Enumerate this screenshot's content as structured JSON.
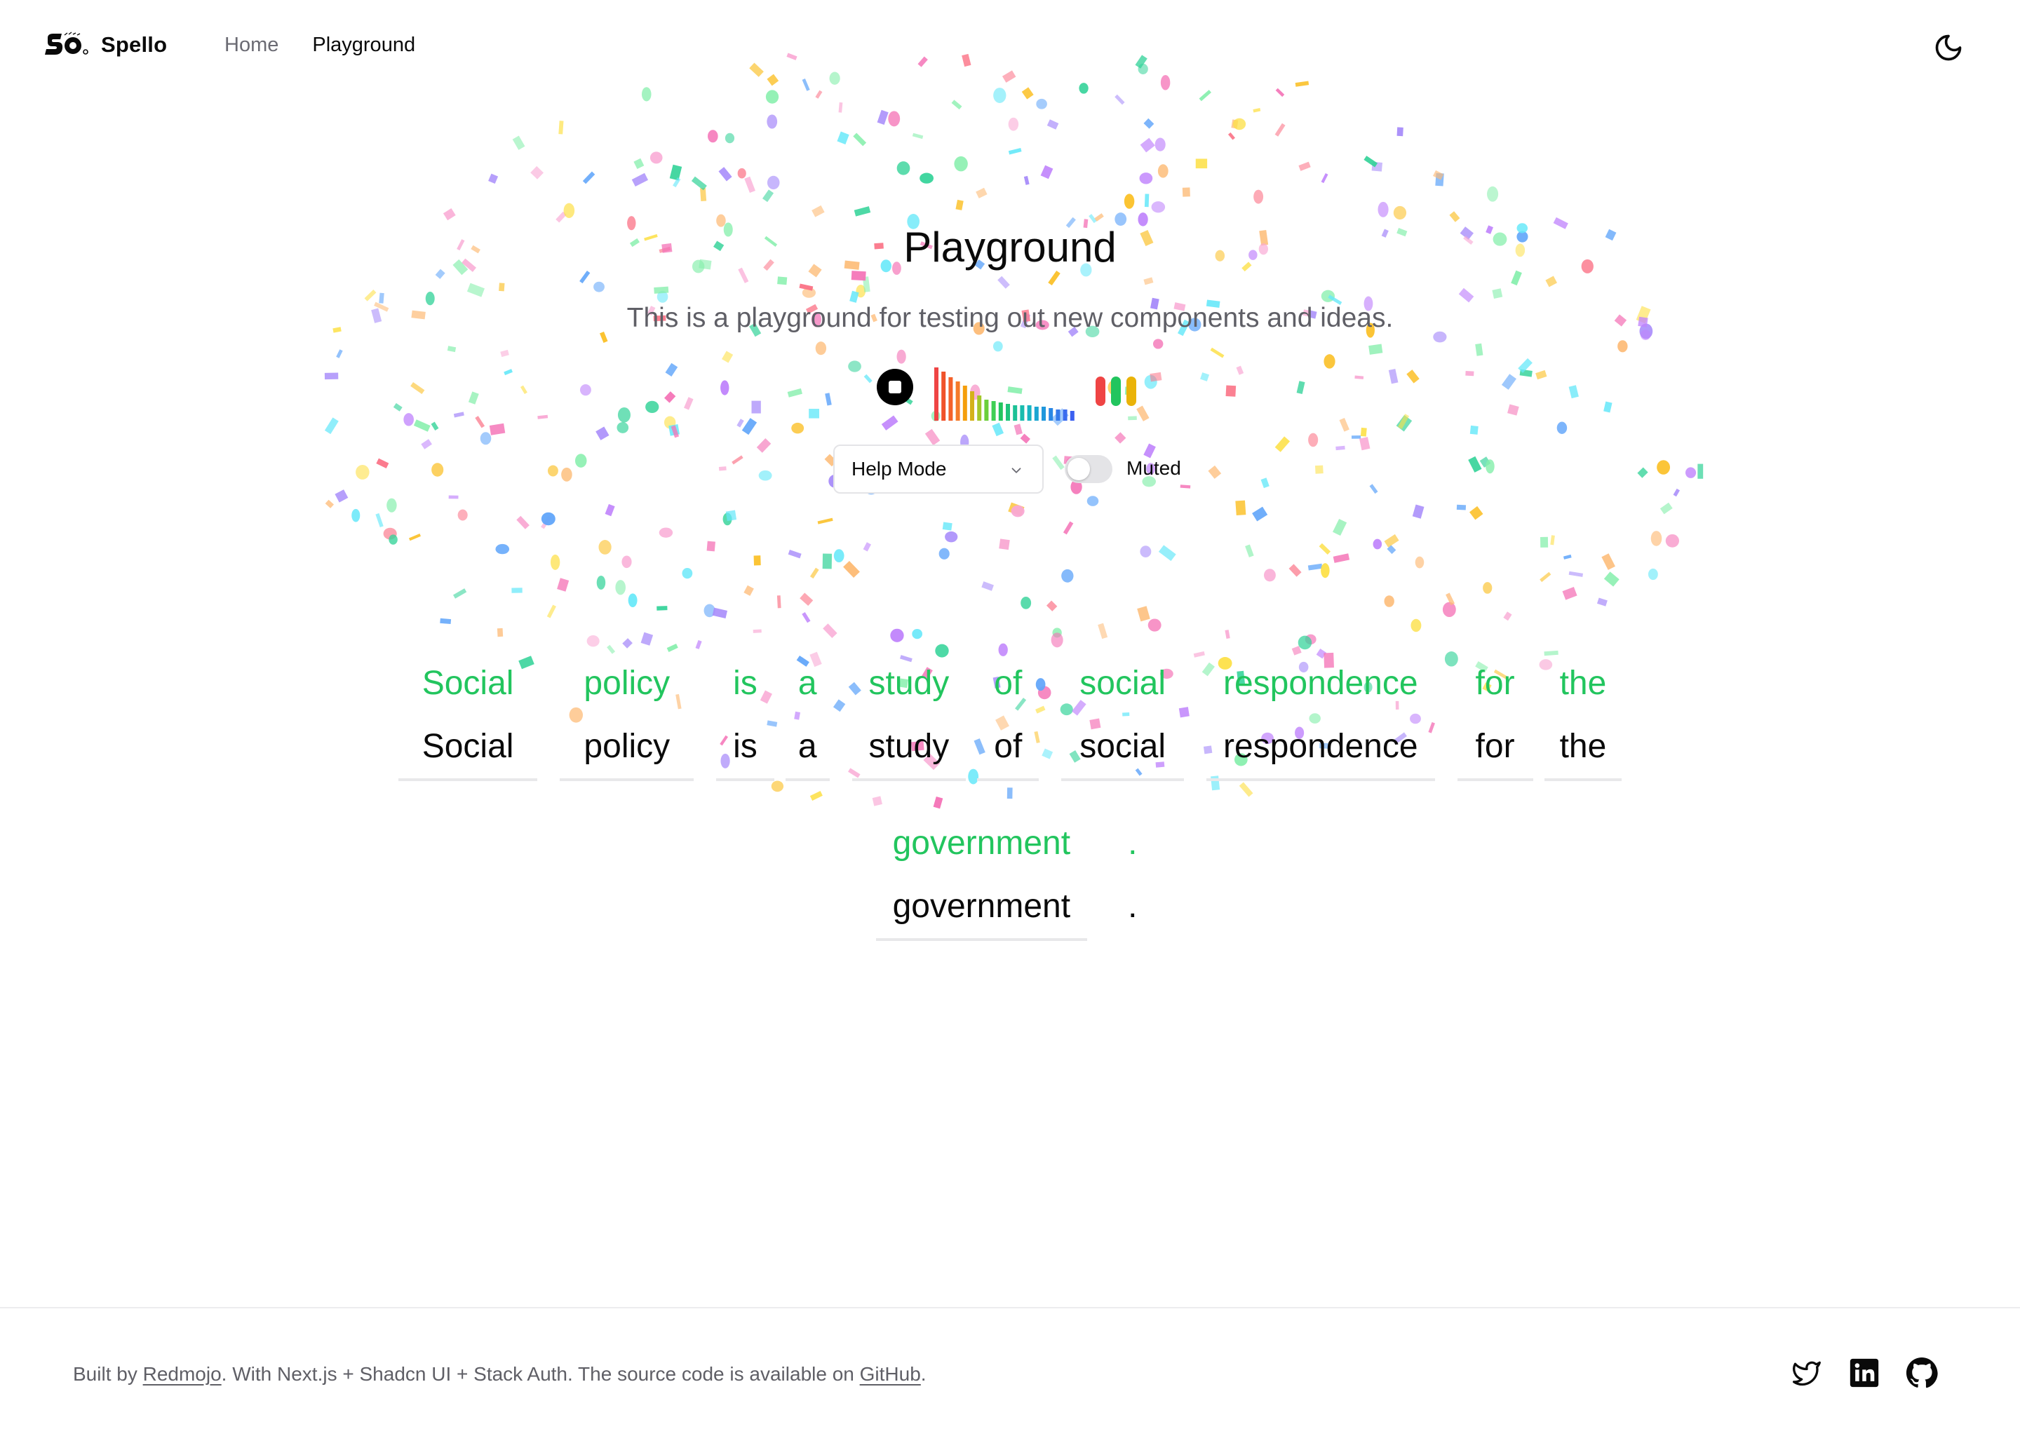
{
  "header": {
    "brand": "Spello",
    "nav": [
      {
        "label": "Home",
        "active": false
      },
      {
        "label": "Playground",
        "active": true
      }
    ],
    "theme_toggle_icon": "moon-icon"
  },
  "main": {
    "title": "Playground",
    "subtitle": "This is a playground for testing out new components and ideas.",
    "recorder": {
      "stop_icon": "stop-icon",
      "status_colors": [
        "#ef4444",
        "#22c55e",
        "#eab308"
      ]
    },
    "mode_select": {
      "value": "Help Mode"
    },
    "mute_toggle": {
      "label": "Muted",
      "on": false
    }
  },
  "words": {
    "row1": [
      {
        "target": "Social",
        "typed": "Social"
      },
      {
        "target": "policy",
        "typed": "policy"
      },
      {
        "target": "is",
        "typed": "is"
      },
      {
        "target": "a",
        "typed": "a"
      },
      {
        "target": "study",
        "typed": "study"
      },
      {
        "target": "of",
        "typed": "of"
      },
      {
        "target": "social",
        "typed": "social"
      },
      {
        "target": "respondence",
        "typed": "respondence"
      },
      {
        "target": "for",
        "typed": "for"
      },
      {
        "target": "the",
        "typed": "the"
      }
    ],
    "row2": [
      {
        "target": "government",
        "typed": "government"
      },
      {
        "target": ".",
        "typed": "."
      }
    ],
    "correct_color": "#22c55e"
  },
  "footer": {
    "prefix": "Built by ",
    "author": "Redmojo",
    "middle": ". With Next.js + Shadcn UI + Stack Auth. The source code is available on ",
    "repo": "GitHub",
    "suffix": ".",
    "socials": [
      "twitter-icon",
      "linkedin-icon",
      "github-icon"
    ]
  }
}
